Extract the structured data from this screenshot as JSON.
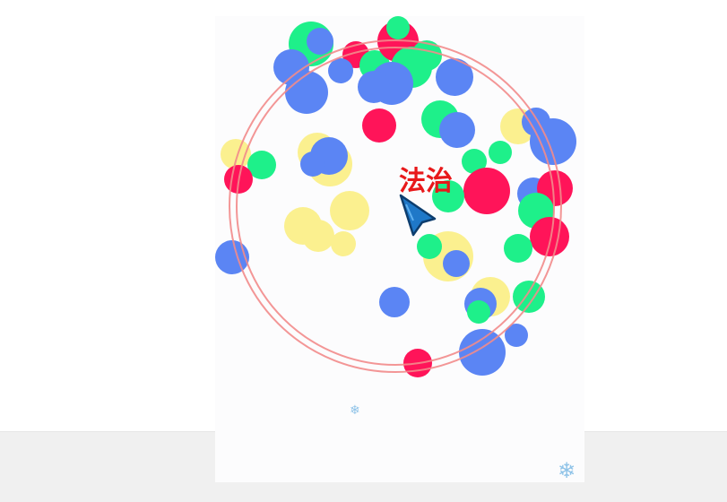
{
  "colors": {
    "page_background": "#ffffff",
    "band_background": "#f0f0f0",
    "stage_background": "#fcfcfd",
    "ring": "#f28b8b",
    "label": "#e8181a",
    "player_fill": "#1f78c8",
    "player_stroke": "#0d3d6e",
    "snowflake": "#8fc3e8",
    "ball_green": "#1ef08a",
    "ball_blue": "#5b85f4",
    "ball_red": "#ff1459",
    "ball_yellow": "#fbf08f"
  },
  "game": {
    "center_label": "法治",
    "player_icon": "arrow-cursor-icon",
    "ball_colors": [
      "green",
      "blue",
      "red",
      "yellow"
    ]
  },
  "decorations": {
    "snowflake_glyph": "❄",
    "icon": "snowflake-icon"
  }
}
